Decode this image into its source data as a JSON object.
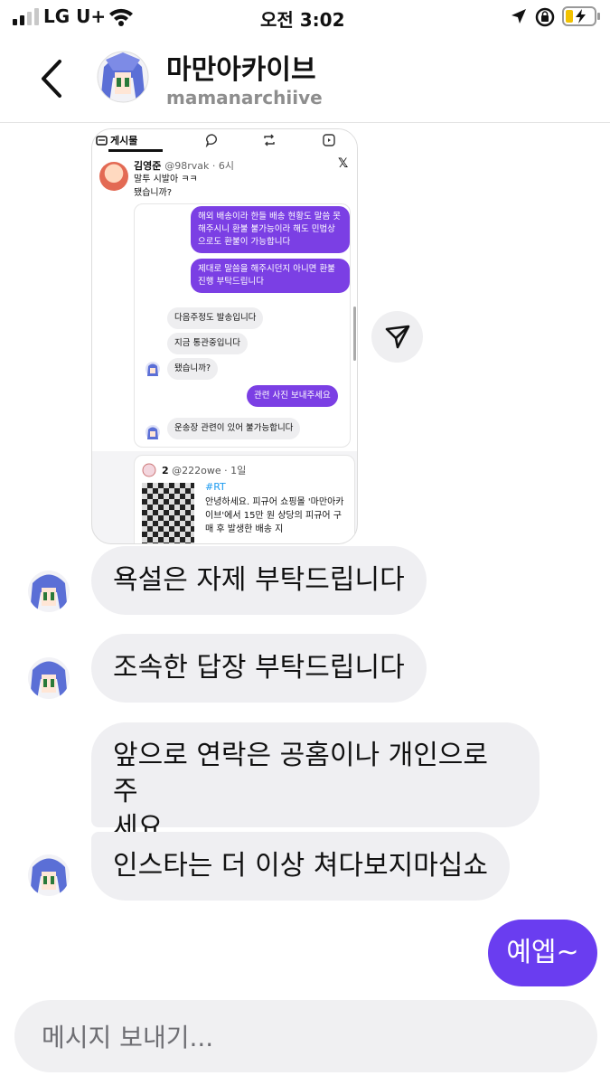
{
  "status_bar": {
    "carrier": "LG U+",
    "time": "오전 3:02"
  },
  "header": {
    "display_name": "마만아카이브",
    "username": "mamanarchiive"
  },
  "shared_post": {
    "tab_label": "게시물",
    "author_name": "김영준",
    "author_handle": "@98rvak · 6시",
    "text_line1": "말투 시발아 ㅋㅋ",
    "text_line2": "됐습니까?",
    "chat": [
      {
        "dir": "out",
        "text": "해외 배송이라 한들 배송 현황도 말씀 못 해주시니 환불 불가능이라 해도 민법상으로도 환불이 가능합니다"
      },
      {
        "dir": "out",
        "text": "제대로 말씀을 해주시던지 아니면 환불 진행 부탁드립니다"
      },
      {
        "dir": "in",
        "text": "다음주정도 발송입니다"
      },
      {
        "dir": "in",
        "text": "지금 통관중입니다"
      },
      {
        "dir": "in",
        "text": "됐습니까?"
      },
      {
        "dir": "out",
        "text": "관련 사진 보내주세요"
      },
      {
        "dir": "in",
        "text": "운송장 관련이 있어 불가능합니다"
      }
    ],
    "quote_author": "2",
    "quote_handle": "@222owe · 1일",
    "quote_hashtag": "#RT",
    "quote_text": "안녕하세요. 피규어 쇼핑몰 '마만아카이브'에서 15만 원 상당의 피규어 구매 후 발생한 배송 지"
  },
  "messages": [
    {
      "dir": "in",
      "text": "욕설은 자제 부탁드립니다"
    },
    {
      "dir": "in",
      "text": "조속한 답장 부탁드립니다"
    },
    {
      "dir": "in",
      "line1": "앞으로 연락은 공홈이나 개인으로 주",
      "line2": "세요"
    },
    {
      "dir": "in",
      "text": "인스타는 더 이상 쳐다보지마십쇼"
    },
    {
      "dir": "out",
      "text": "예엡~"
    }
  ],
  "composer": {
    "placeholder": "메시지 보내기..."
  },
  "icons": {
    "back": "chevron-left-icon",
    "share": "send-icon",
    "accent_color": "#6a3df0",
    "incoming_bubble_color": "#efeff2"
  }
}
